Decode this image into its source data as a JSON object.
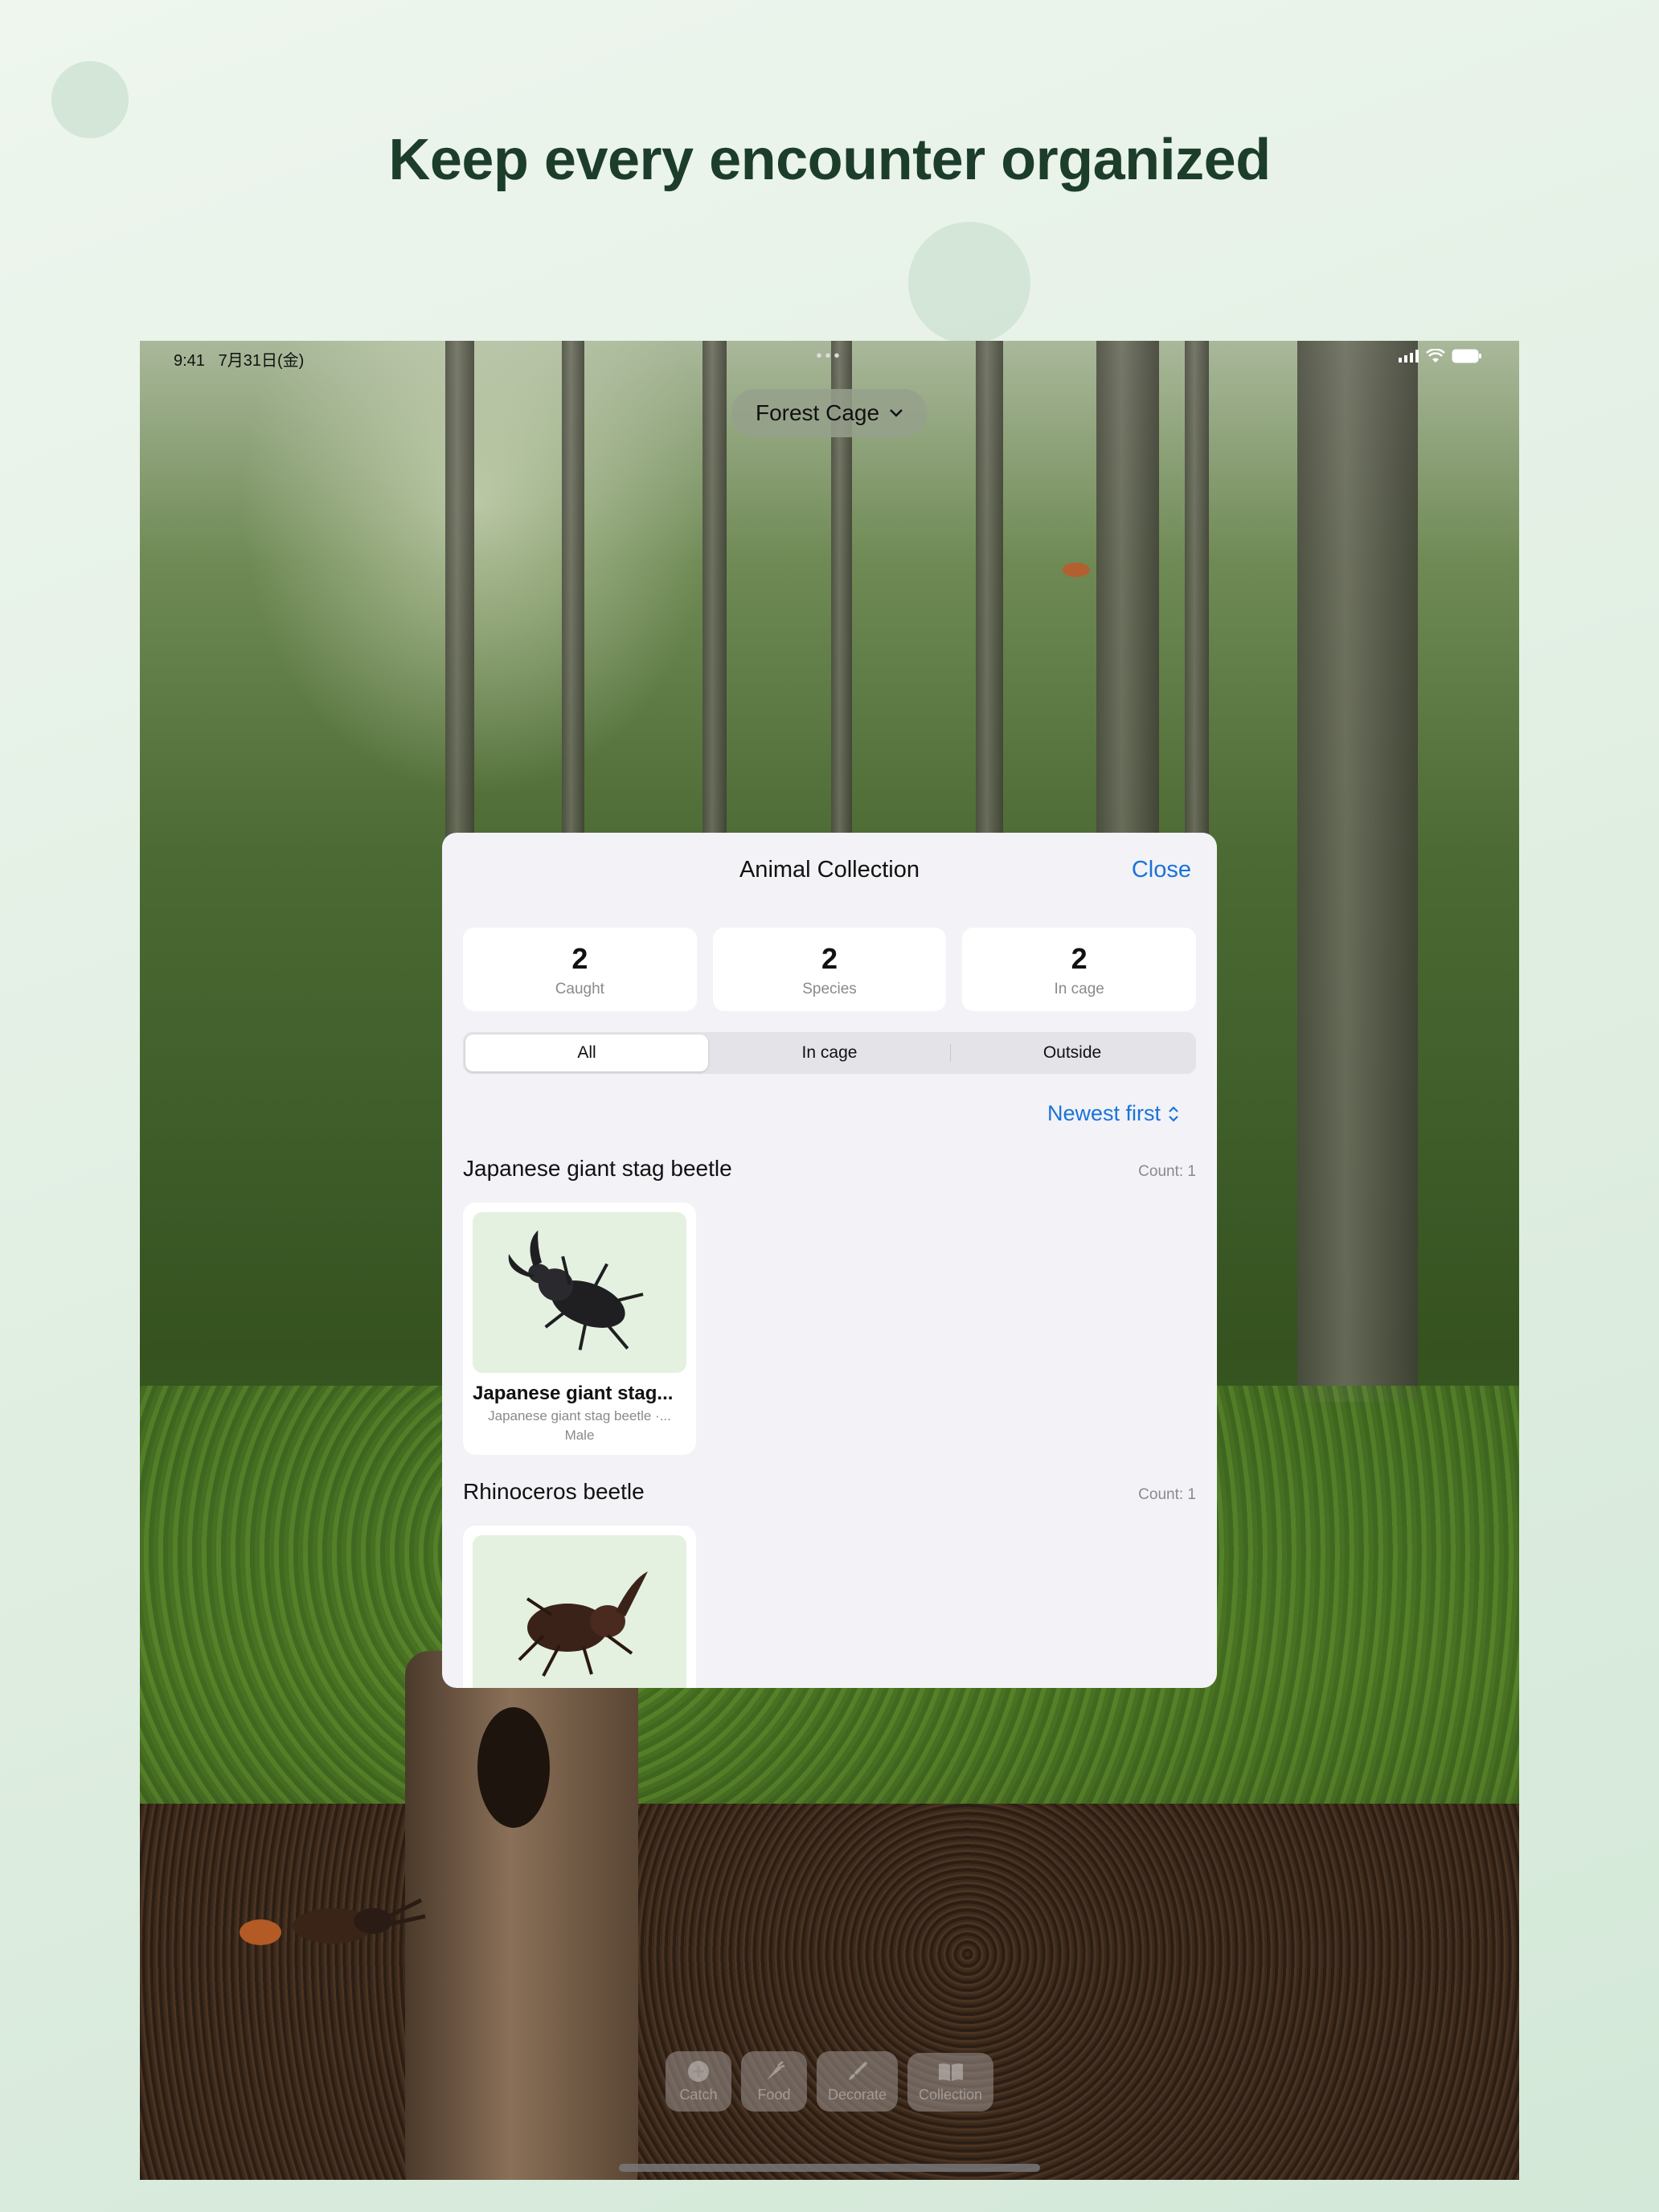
{
  "headline": "Keep every encounter organized",
  "status_bar": {
    "time": "9:41",
    "date": "7月31日(金)",
    "dots": "•••"
  },
  "cage_selector": {
    "label": "Forest Cage"
  },
  "modal": {
    "title": "Animal Collection",
    "close_label": "Close",
    "stats": [
      {
        "value": "2",
        "label": "Caught"
      },
      {
        "value": "2",
        "label": "Species"
      },
      {
        "value": "2",
        "label": "In cage"
      }
    ],
    "segments": [
      {
        "label": "All",
        "selected": true
      },
      {
        "label": "In cage",
        "selected": false
      },
      {
        "label": "Outside",
        "selected": false
      }
    ],
    "sort_label": "Newest first",
    "sections": [
      {
        "title": "Japanese giant stag beetle",
        "count": "Count: 1",
        "card": {
          "name": "Japanese giant stag...",
          "subtitle": "Japanese giant stag beetle ·...",
          "sex": "Male"
        }
      },
      {
        "title": "Rhinoceros beetle",
        "count": "Count: 1"
      }
    ]
  },
  "toolbar": [
    {
      "label": "Catch",
      "icon": "plus-circle-icon"
    },
    {
      "label": "Food",
      "icon": "carrot-icon"
    },
    {
      "label": "Decorate",
      "icon": "paintbrush-icon"
    },
    {
      "label": "Collection",
      "icon": "book-icon"
    }
  ],
  "colors": {
    "accent": "#1a73d9",
    "headline": "#1c3d2a",
    "modal_bg": "#f2f2f7"
  }
}
